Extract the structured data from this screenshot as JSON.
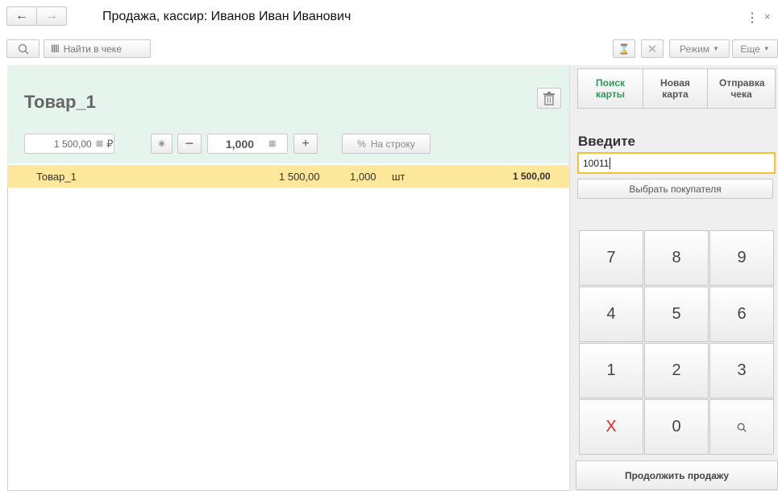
{
  "header": {
    "title": "Продажа, кассир: Иванов Иван Иванович",
    "back_icon": "←",
    "forward_icon": "→"
  },
  "toolbar": {
    "search_placeholder": "Найти в чеке",
    "mode_label": "Режим",
    "more_label": "Еще"
  },
  "product": {
    "name": "Товар_1",
    "price": "1 500,00",
    "currency": "₽",
    "quantity": "1,000",
    "discount_label": "На строку"
  },
  "receipt_rows": [
    {
      "name": "Товар_1",
      "price": "1 500,00",
      "qty": "1,000",
      "unit": "шт",
      "sum": "1 500,00"
    }
  ],
  "right_panel": {
    "tabs": [
      {
        "label": "Поиск карты",
        "active": true
      },
      {
        "label": "Новая карта",
        "active": false
      },
      {
        "label": "Отправка чека",
        "active": false
      }
    ],
    "prompt": "Введите",
    "input_value": "10011",
    "choose_customer": "Выбрать покупателя",
    "keys": [
      "7",
      "8",
      "9",
      "4",
      "5",
      "6",
      "1",
      "2",
      "3",
      "X",
      "0",
      "search-icon"
    ],
    "continue_label": "Продолжить продажу"
  },
  "colors": {
    "accent_green": "#2e9a5a",
    "highlight": "#fde79a",
    "panel": "#e5f4ed",
    "input_border": "#f2c230",
    "cancel": "#e22"
  }
}
